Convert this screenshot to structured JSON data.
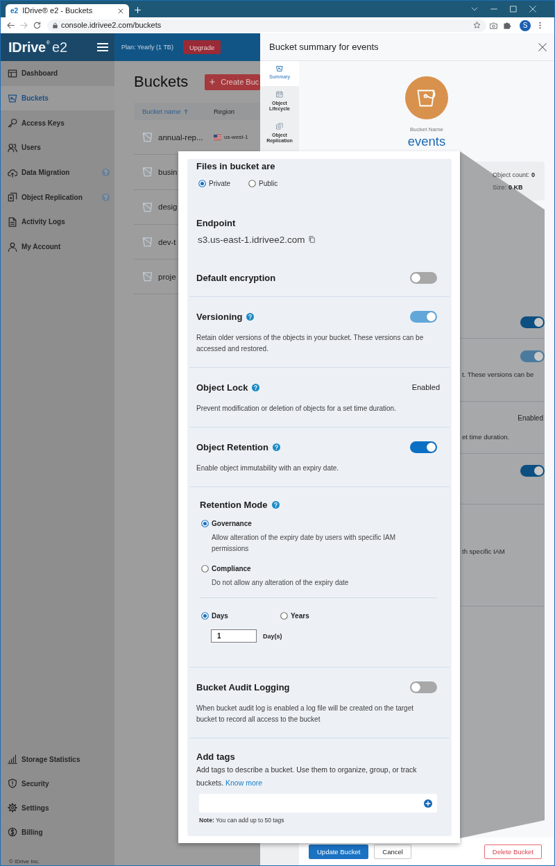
{
  "browser": {
    "tab": {
      "favicon": "e2",
      "title": "IDrive® e2 - Buckets"
    },
    "url": "console.idrivee2.com/buckets",
    "profile": "S"
  },
  "header": {
    "logo": {
      "brand": "IDrive",
      "mark": "®",
      "product": "e2"
    },
    "plan": "Plan: Yearly (1 TB)",
    "upgrade": "Upgrade"
  },
  "sidebar": {
    "items": [
      {
        "label": "Dashboard",
        "selected": false,
        "help": false
      },
      {
        "label": "Buckets",
        "selected": true,
        "help": false
      },
      {
        "label": "Access Keys",
        "selected": false,
        "help": false
      },
      {
        "label": "Users",
        "selected": false,
        "help": false
      },
      {
        "label": "Data Migration",
        "selected": false,
        "help": true
      },
      {
        "label": "Object Replication",
        "selected": false,
        "help": true
      },
      {
        "label": "Activity Logs",
        "selected": false,
        "help": false
      },
      {
        "label": "My Account",
        "selected": false,
        "help": false
      }
    ],
    "bottom_items": [
      {
        "label": "Storage Statistics",
        "selected": false
      },
      {
        "label": "Security",
        "selected": false
      },
      {
        "label": "Settings",
        "selected": false
      },
      {
        "label": "Billing",
        "selected": false
      }
    ],
    "copyright": "© IDrive Inc."
  },
  "page": {
    "title": "Buckets",
    "create_button": "Create Buc",
    "table": {
      "columns": [
        {
          "label": "Bucket name",
          "sorted": true
        },
        {
          "label": "Region",
          "sorted": false
        }
      ],
      "rows": [
        {
          "name": "annual-rep...",
          "region": "us-west-1"
        },
        {
          "name": "busin"
        },
        {
          "name": "desig"
        },
        {
          "name": "dev-t"
        },
        {
          "name": "proje"
        }
      ]
    }
  },
  "drawer": {
    "title": "Bucket summary for events",
    "tabs": [
      {
        "label": "Summary",
        "selected": true
      },
      {
        "label": "Object Lifecycle",
        "selected": false
      },
      {
        "label": "Object Replication",
        "selected": false
      }
    ],
    "bucket_label": "Bucket Name",
    "bucket_name": "events",
    "stats": [
      {
        "label": "Object count:",
        "value": "0"
      },
      {
        "label": "Size:",
        "value": "0 KB"
      }
    ],
    "rows": [
      {
        "toggle": {
          "on": true,
          "disabled": false
        }
      },
      {
        "toggle": {
          "on": true,
          "disabled": true
        },
        "text": "t. These versions can be"
      },
      {
        "status": "Enabled",
        "text": "et time duration."
      },
      {
        "toggle": {
          "on": true,
          "disabled": false
        }
      },
      {
        "text": "th specific IAM"
      }
    ],
    "buttons": [
      {
        "label": "Update Bucket",
        "kind": "primary"
      },
      {
        "label": "Cancel",
        "kind": "secondary"
      },
      {
        "label": "Delete Bucket",
        "kind": "danger"
      }
    ]
  },
  "magnifier": {
    "sections": [
      {
        "kind": "radio_group",
        "title": "Files in bucket are",
        "options": [
          {
            "label": "Private",
            "selected": true
          },
          {
            "label": "Public",
            "selected": false
          }
        ]
      },
      {
        "kind": "endpoint",
        "title": "Endpoint",
        "value": "s3.us-east-1.idrivee2.com"
      },
      {
        "kind": "toggle",
        "title": "Default encryption",
        "help": false,
        "on": false,
        "disabled": false
      },
      {
        "kind": "toggle",
        "title": "Versioning",
        "help": true,
        "on": true,
        "disabled": true,
        "description": "Retain older versions of the objects in your bucket. These versions can be accessed and restored."
      },
      {
        "kind": "status",
        "title": "Object Lock",
        "help": true,
        "status": "Enabled",
        "description": "Prevent modification or deletion of objects for a set time duration."
      },
      {
        "kind": "toggle",
        "title": "Object Retention",
        "help": true,
        "on": true,
        "disabled": false,
        "description": "Enable object immutability with an expiry date."
      },
      {
        "kind": "retention_mode",
        "title": "Retention Mode",
        "help": true,
        "modes": [
          {
            "label": "Governance",
            "selected": true,
            "description": "Allow alteration of the expiry date by users with specific IAM permissions"
          },
          {
            "label": "Compliance",
            "selected": false,
            "description": "Do not allow any alteration of the expiry date"
          }
        ],
        "units": [
          {
            "label": "Days",
            "selected": true
          },
          {
            "label": "Years",
            "selected": false
          }
        ],
        "duration_value": "1",
        "duration_unit": "Day(s)"
      },
      {
        "kind": "toggle",
        "title": "Bucket Audit Logging",
        "help": false,
        "on": false,
        "disabled": false,
        "description": "When bucket audit log is enabled a log file will be created on the target bucket to record all access to the bucket"
      },
      {
        "kind": "tags",
        "title": "Add tags",
        "description": "Add tags to describe a bucket. Use them to organize, group, or track buckets.",
        "link": "Know more",
        "note": "**Note:** You can add up to 50 tags"
      }
    ]
  }
}
